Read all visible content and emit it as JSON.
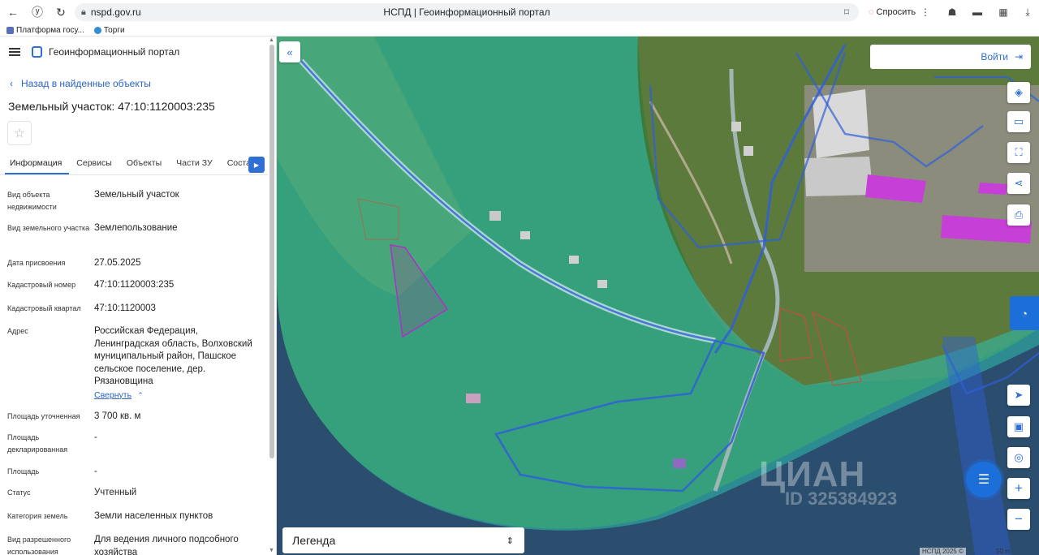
{
  "browser": {
    "url": "nspd.gov.ru",
    "tab_title": "НСПД | Геоинформационный портал",
    "ask_label": "Спросить",
    "bookmarks": [
      "Платформа госу...",
      "Торги"
    ]
  },
  "app": {
    "name": "Геоинформационный портал",
    "back_label": "Назад в найденные объекты",
    "title": "Земельный участок: 47:10:1120003:235"
  },
  "tabs": [
    "Информация",
    "Сервисы",
    "Объекты",
    "Части ЗУ",
    "Соста..."
  ],
  "attributes": [
    {
      "key": "Вид объекта недвижимости",
      "value": "Земельный участок"
    },
    {
      "key": "Вид земельного участка",
      "value": "Землепользование"
    },
    {
      "key": "Дата присвоения",
      "value": "27.05.2025"
    },
    {
      "key": "Кадастровый номер",
      "value": "47:10:1120003:235"
    },
    {
      "key": "Кадастровый квартал",
      "value": "47:10:1120003"
    },
    {
      "key": "Адрес",
      "value": "Российская Федерация, Ленинградская область, Волховский муниципальный район, Пашское сельское поселение, дер. Рязановщина"
    },
    {
      "key": "Площадь уточненная",
      "value": "3 700 кв. м"
    },
    {
      "key": "Площадь декларированная",
      "value": "-"
    },
    {
      "key": "Площадь",
      "value": "-"
    },
    {
      "key": "Статус",
      "value": "Учтенный"
    },
    {
      "key": "Категория земель",
      "value": "Земли населенных пунктов"
    },
    {
      "key": "Вид разрешенного использования",
      "value": "Для ведения личного подсобного хозяйства"
    }
  ],
  "collapse_label": "Свернуть",
  "map": {
    "login_label": "Войти",
    "legend_label": "Легенда",
    "watermark": "ЦИАН",
    "watermark_id": "ID 325384923",
    "copyright": "НСПД 2025 ©",
    "scale": "50 m",
    "colors": {
      "water": "#2b4e6e",
      "forest": "#3e7a3a",
      "overlay": "#2dbfb0",
      "boundary": "#2f5fd8",
      "parcel": "#9b2fb0",
      "roof_pink": "#c63fd6"
    }
  }
}
